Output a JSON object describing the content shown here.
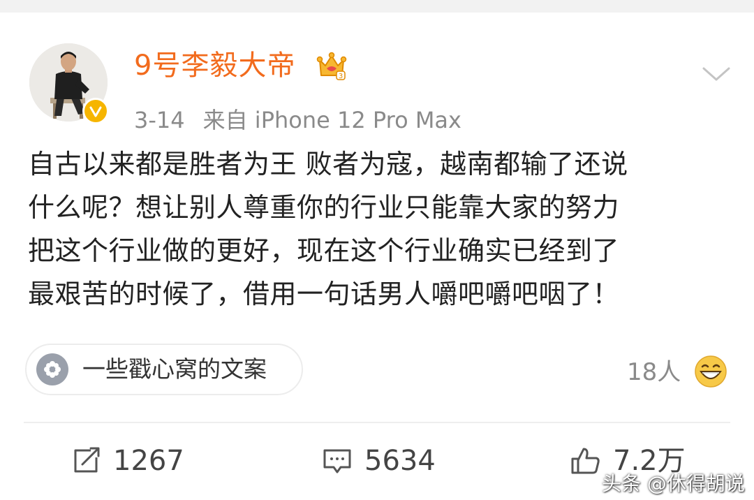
{
  "post": {
    "author": {
      "username": "9号李毅大帝",
      "avatar_icon": "user-avatar",
      "verified_icon": "verified-badge-icon",
      "crown_icon": "crown-level-icon"
    },
    "meta": {
      "date": "3-14",
      "source": "来自 iPhone 12 Pro Max"
    },
    "text_lines": [
      "自古以来都是胜者为王 败者为寇，越南都输了还说",
      "什么呢？想让别人尊重你的行业只能靠大家的努力",
      "把这个行业做的更好，现在这个行业确实已经到了",
      "最艰苦的时候了，借用一句话男人嚼吧嚼吧咽了！"
    ],
    "topic": {
      "label": "一些戳心窝的文案",
      "icon": "topic-flower-icon"
    },
    "reactions": {
      "count": "18人",
      "emoji_icon": "grin-emoji-icon"
    },
    "actions": {
      "repost": {
        "count": "1267",
        "icon": "repost-icon"
      },
      "comment": {
        "count": "5634",
        "icon": "comment-icon"
      },
      "like": {
        "count": "7.2万",
        "icon": "like-icon"
      }
    }
  },
  "watermark": "头条 @休得胡说",
  "colors": {
    "username": "#f26b1d",
    "verified_badge": "#f6b500",
    "meta_text": "#8a8a8a",
    "body_text": "#222222",
    "topic_icon_bg": "#9aa0ab"
  }
}
